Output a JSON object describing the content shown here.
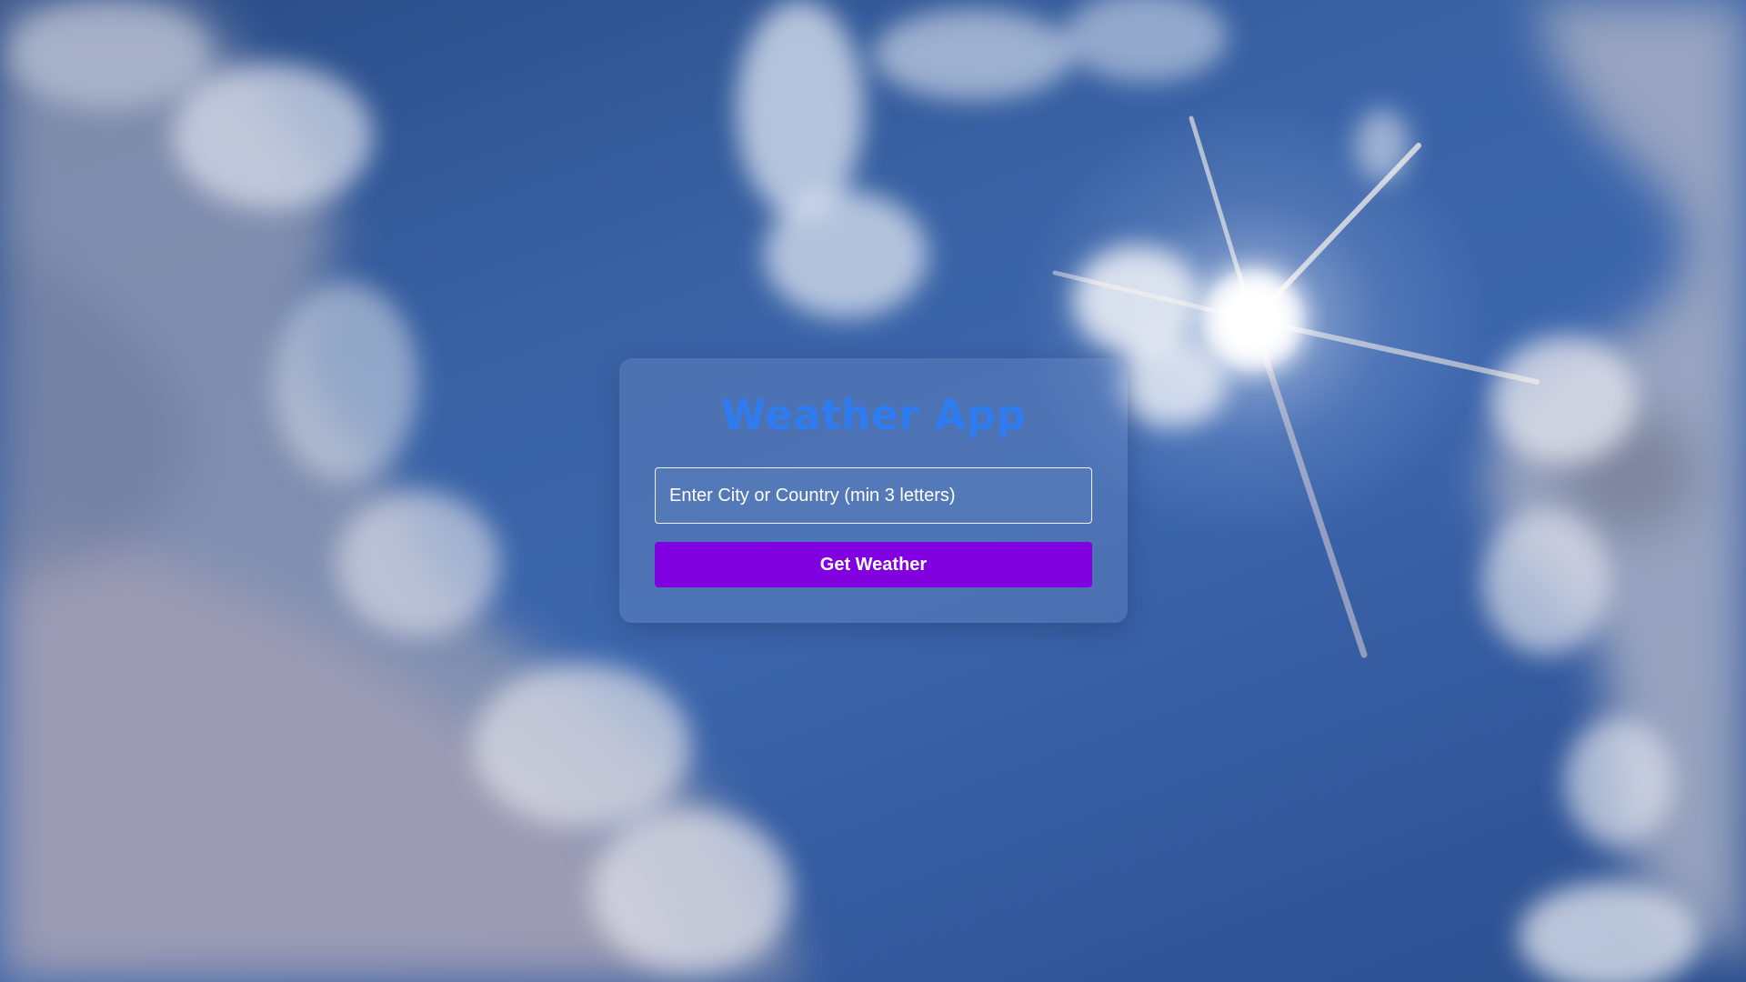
{
  "app": {
    "title": "Weather App"
  },
  "search": {
    "placeholder": "Enter City or Country (min 3 letters)",
    "value": ""
  },
  "actions": {
    "get_weather_label": "Get Weather"
  },
  "colors": {
    "title": "#2f7bf0",
    "button": "#8000e0",
    "sky": "#3a63a6"
  }
}
